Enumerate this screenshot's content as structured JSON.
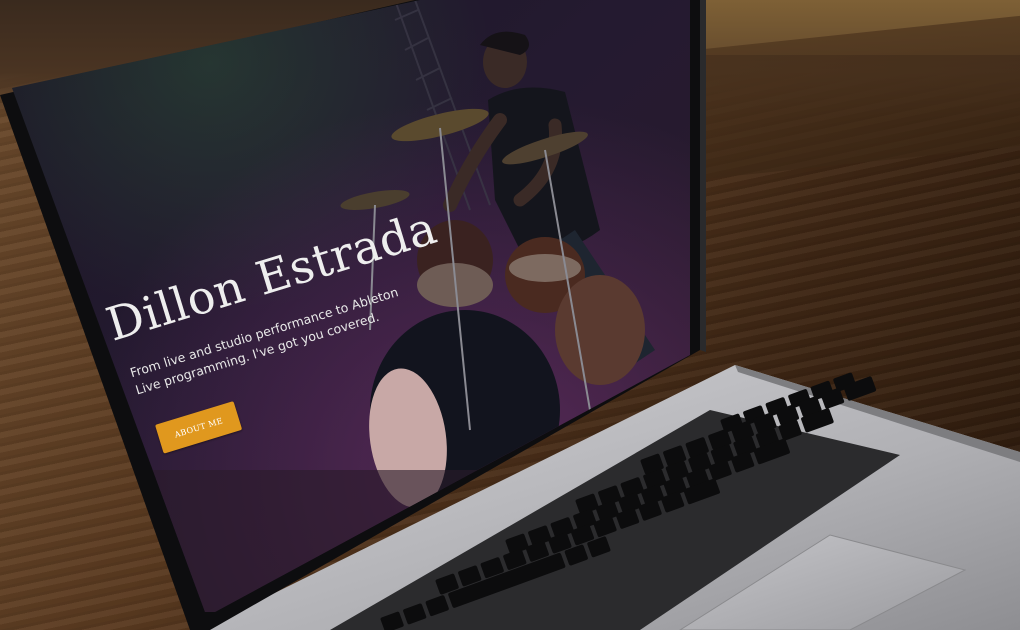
{
  "hero": {
    "name": "Dillon Estrada",
    "subtitle": "From live and studio performance to Ableton Live programming. I've got you covered.",
    "cta_label": "ABOUT ME"
  },
  "colors": {
    "cta": "#e0981e",
    "screen_bg": "#1c1a22",
    "laptop_body": "#b8b8bc",
    "key": "#111111"
  },
  "icons": [
    "laptop-icon",
    "drum-kit-photo",
    "keyboard",
    "trackpad"
  ]
}
